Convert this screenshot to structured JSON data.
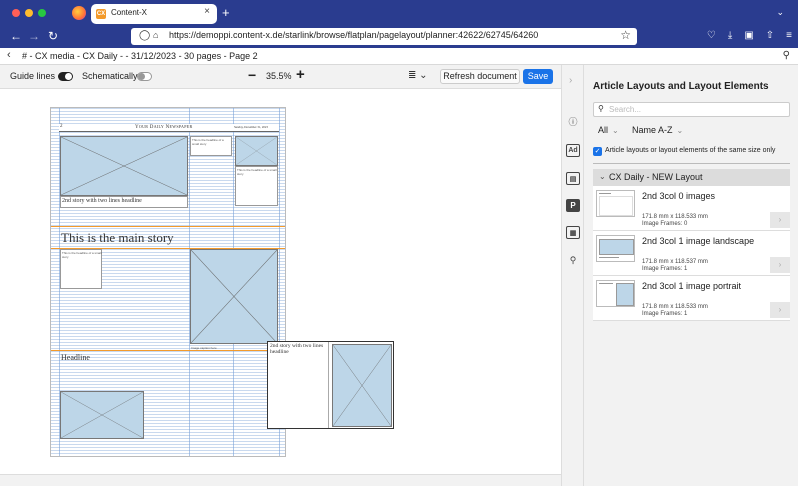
{
  "browser": {
    "tab_title": "Content-X",
    "tab_favicon": "CX",
    "url": "https://demoppi.content-x.de/starlink/browse/flatplan/pagelayout/planner:42622/62745/64260"
  },
  "breadcrumb": {
    "text": "# - CX media - CX Daily - - 31/12/2023 - 30 pages - Page 2"
  },
  "toolbar": {
    "guide_lines_label": "Guide lines",
    "guide_lines_on": true,
    "schematically_label": "Schematically",
    "schematically_on": false,
    "zoom_value": "35.5%",
    "refresh_label": "Refresh document",
    "save_label": "Save"
  },
  "page": {
    "masthead": "Your Daily Newspaper",
    "page_number": "2",
    "date_line": "Sunday, December 31, 2023",
    "story2_headline": "2nd story with two lines headline",
    "main_headline": "This is the main story",
    "small_headline_a": "This is the headline of a small story",
    "small_headline_b": "This is the headline of a small story",
    "side_headline": "This is the headline of a small story",
    "sub_headline": "Headline",
    "drag_headline": "2nd story with two lines headline",
    "image_caption": "Image caption here"
  },
  "panel": {
    "title": "Article Layouts and Layout Elements",
    "search_placeholder": "Search...",
    "filter_all": "All",
    "filter_sort": "Name A-Z",
    "same_size_label": "Article layouts or layout elements of the same size only",
    "same_size_checked": true,
    "group_label": "CX Daily - NEW Layout",
    "layouts": [
      {
        "name": "2nd 3col 0 images",
        "size": "171.8 mm x 118.533 mm",
        "frames": "Image Frames: 0"
      },
      {
        "name": "2nd 3col 1 image landscape",
        "size": "171.8 mm x 118.537 mm",
        "frames": "Image Frames: 1"
      },
      {
        "name": "2nd 3col 1 image portrait",
        "size": "171.8 mm x 118.533 mm",
        "frames": "Image Frames: 1"
      }
    ]
  },
  "icons": {
    "rail": [
      "info-icon",
      "ad-icon",
      "page-icon",
      "p-icon",
      "layout-icon",
      "search-icon"
    ]
  },
  "colors": {
    "browser_chrome": "#2a3c8f",
    "save_button": "#1a73e8",
    "guide_orange": "#f39a2b",
    "image_placeholder": "#bdd6e8"
  }
}
